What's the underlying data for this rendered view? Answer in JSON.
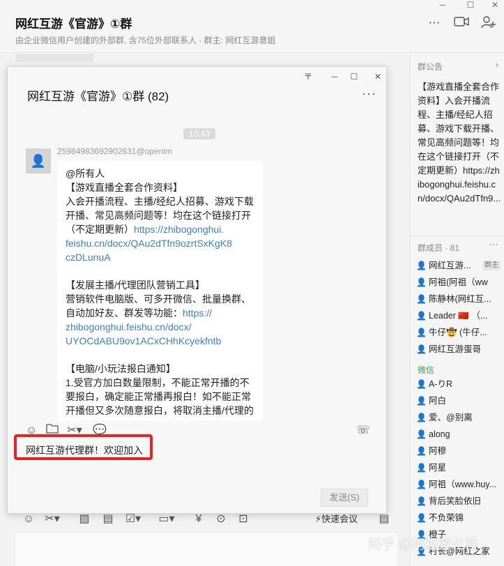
{
  "header": {
    "title": "网红互游《官游》①群",
    "subtitle": "由企业微信用户创建的外部群, 含75位外部联系人 · 群主: 网红互游意姐"
  },
  "dialog": {
    "title": "网红互游《官游》①群 (82)",
    "time": "10:43",
    "sender": "25984983692902631@openim",
    "message_lines": [
      {
        "text": "@所有人",
        "kind": "text"
      },
      {
        "text": "【游戏直播全套合作资料】",
        "kind": "text"
      },
      {
        "text": "入会开播流程、主播/经纪人招募、游戏下载",
        "kind": "text"
      },
      {
        "text": "开播、常见高频问题等！均在这个链接打开",
        "kind": "text"
      },
      {
        "text": "（不定期更新）",
        "kind": "text",
        "link": "https://zhibogonghui."
      },
      {
        "text": "feishu.cn/docx/QAu2dTfn9ozrtSxKgK8",
        "kind": "link"
      },
      {
        "text": "czDLunuA",
        "kind": "link"
      },
      {
        "text": "",
        "kind": "gap"
      },
      {
        "text": "【发展主播/代理团队营销工具】",
        "kind": "text"
      },
      {
        "text": "营销软件电脑版、可多开微信、批量换群、",
        "kind": "text"
      },
      {
        "text": "自动加好友、群发等功能：",
        "kind": "text",
        "link": "https://"
      },
      {
        "text": "zhibogonghui.feishu.cn/docx/",
        "kind": "link"
      },
      {
        "text": "UYOCdABU9ov1ACxCHhKcyekfntb",
        "kind": "link"
      },
      {
        "text": "",
        "kind": "gap"
      },
      {
        "text": "【电脑/小玩法报白通知】",
        "kind": "text"
      },
      {
        "text": "1.受官方加白数量限制，不能正常开播的不",
        "kind": "text"
      },
      {
        "text": "要报白，确定能正常播再报白！如不能正常",
        "kind": "text"
      },
      {
        "text": "开播但又多次随意报白，将取消主播/代理的",
        "kind": "text"
      }
    ],
    "input_text": "网红互游代理群！欢迎加入",
    "send_label": "发送(S)"
  },
  "main_toolbar": {
    "meeting_label": "快速会议"
  },
  "sidebar": {
    "notice_title": "群公告",
    "notice_text": "【游戏直播全套合作资料】入会开播流程、主播/经纪人招募、游戏下载开播、常见高频问题等！均在这个链接打开（不定期更新）https://zhibogonghui.feishu.cn/docx/QAu2dTfn9...",
    "members_title": "群成员 · 81",
    "owner_badge": "群主",
    "members": [
      {
        "name": "网红互游...",
        "icon": "orange"
      },
      {
        "name": "阿祖(阿祖（ww",
        "icon": "blue"
      },
      {
        "name": "陈静林(网红互...",
        "icon": "orange"
      },
      {
        "name": "Leader 🇨🇳 （...",
        "icon": "blue"
      },
      {
        "name": "牛仔🤠 (牛仔...",
        "icon": "orange"
      },
      {
        "name": "网红互游蛋哥",
        "icon": "blue"
      }
    ],
    "wechat_label": "微信",
    "wechat_members": [
      {
        "name": "A-りR",
        "icon": "blue"
      },
      {
        "name": "阿白",
        "icon": "orange"
      },
      {
        "name": "爱、@别离",
        "icon": "blue"
      },
      {
        "name": "along",
        "icon": "blue"
      },
      {
        "name": "阿穆",
        "icon": "blue"
      },
      {
        "name": "阿星",
        "icon": "blue"
      },
      {
        "name": "阿祖（www.huy...",
        "icon": "blue"
      },
      {
        "name": "背后笑脸依旧",
        "icon": "blue"
      },
      {
        "name": "不负荣锦",
        "icon": "blue"
      },
      {
        "name": "橙子",
        "icon": "blue"
      },
      {
        "name": "村长@网红之家",
        "icon": "blue"
      }
    ]
  },
  "watermark": "知乎 @阿祖孵化营",
  "colors": {
    "highlight": "#e8221e",
    "link": "#3b7fc4",
    "wechat_green": "#3aa55d"
  }
}
